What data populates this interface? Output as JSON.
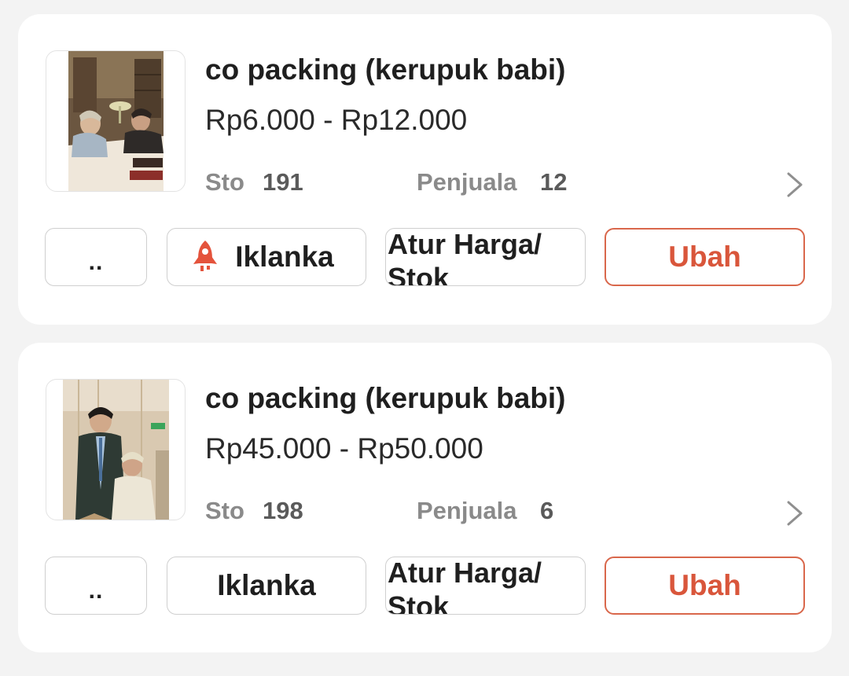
{
  "products": [
    {
      "name": "co packing (kerupuk babi)",
      "price": "Rp6.000 - Rp12.000",
      "stock_label": "Sto",
      "stock_value": "191",
      "sales_label": "Penjuala",
      "sales_value": "12",
      "has_ad_icon": true,
      "photo": "two men talking at a library table",
      "buttons": {
        "more": "..",
        "ads": "Iklanka",
        "price_stock": "Atur Harga/ Stok",
        "edit": "Ubah"
      }
    },
    {
      "name": "co packing (kerupuk babi)",
      "price": "Rp45.000 - Rp50.000",
      "stock_label": "Sto",
      "stock_value": "198",
      "sales_label": "Penjuala",
      "sales_value": "6",
      "has_ad_icon": false,
      "photo": "two men posing in a hallway",
      "buttons": {
        "more": "..",
        "ads": "Iklanka",
        "price_stock": "Atur Harga/ Stok",
        "edit": "Ubah"
      }
    }
  ],
  "colors": {
    "accent": "#d9563b",
    "rocket": "#e4533c",
    "background": "#f3f3f3"
  },
  "icons": {
    "ad": "rocket-icon",
    "detail": "chevron-right-icon"
  }
}
